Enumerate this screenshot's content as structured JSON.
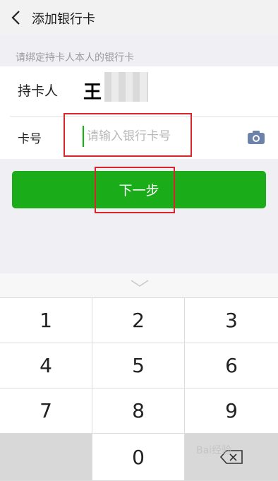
{
  "header": {
    "title": "添加银行卡",
    "back_icon": "back-arrow-icon"
  },
  "hint": "请绑定持卡人本人的银行卡",
  "form": {
    "holder_label": "持卡人",
    "holder_name": "王",
    "card_label": "卡号",
    "card_placeholder": "请输入银行卡号",
    "camera_icon": "camera-icon"
  },
  "next_button": "下一步",
  "accent_color": "#1aad19",
  "highlight_color": "#d9262c",
  "keyboard": {
    "keys": [
      "1",
      "2",
      "3",
      "4",
      "5",
      "6",
      "7",
      "8",
      "9",
      "0"
    ],
    "delete_icon": "backspace-icon",
    "collapse_icon": "chevron-down-icon"
  },
  "watermark": "Bai经验"
}
